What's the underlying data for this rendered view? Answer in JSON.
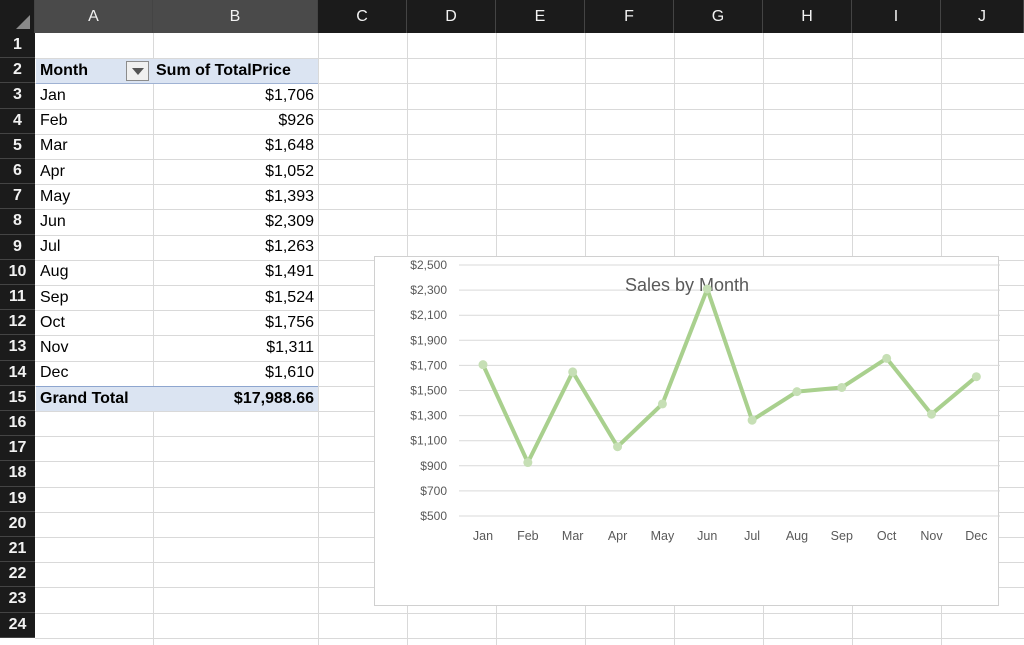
{
  "sheet": {
    "columns": [
      "A",
      "B",
      "C",
      "D",
      "E",
      "F",
      "G",
      "H",
      "I",
      "J"
    ],
    "rows": [
      "1",
      "2",
      "3",
      "4",
      "5",
      "6",
      "7",
      "8",
      "9",
      "10",
      "11",
      "12",
      "13",
      "14",
      "15",
      "16",
      "17",
      "18",
      "19",
      "20",
      "21",
      "22",
      "23",
      "24"
    ]
  },
  "pivot": {
    "row_header": "Month",
    "value_header": "Sum of TotalPrice",
    "rows": [
      {
        "month": "Jan",
        "value": "$1,706"
      },
      {
        "month": "Feb",
        "value": "$926"
      },
      {
        "month": "Mar",
        "value": "$1,648"
      },
      {
        "month": "Apr",
        "value": "$1,052"
      },
      {
        "month": "May",
        "value": "$1,393"
      },
      {
        "month": "Jun",
        "value": "$2,309"
      },
      {
        "month": "Jul",
        "value": "$1,263"
      },
      {
        "month": "Aug",
        "value": "$1,491"
      },
      {
        "month": "Sep",
        "value": "$1,524"
      },
      {
        "month": "Oct",
        "value": "$1,756"
      },
      {
        "month": "Nov",
        "value": "$1,311"
      },
      {
        "month": "Dec",
        "value": "$1,610"
      }
    ],
    "total_label": "Grand Total",
    "total_value": "$17,988.66",
    "header_fill": "#dbe4f2"
  },
  "chart_data": {
    "type": "line",
    "title": "Sales by Month",
    "categories": [
      "Jan",
      "Feb",
      "Mar",
      "Apr",
      "May",
      "Jun",
      "Jul",
      "Aug",
      "Sep",
      "Oct",
      "Nov",
      "Dec"
    ],
    "series": [
      {
        "values": [
          1706,
          926,
          1648,
          1052,
          1393,
          2309,
          1263,
          1491,
          1524,
          1756,
          1311,
          1610
        ]
      }
    ],
    "ylim": [
      500,
      2500
    ],
    "yticks": [
      "$500",
      "$700",
      "$900",
      "$1,100",
      "$1,300",
      "$1,500",
      "$1,700",
      "$1,900",
      "$2,100",
      "$2,300",
      "$2,500"
    ],
    "grid": true,
    "line_color": "#a9d08e"
  }
}
